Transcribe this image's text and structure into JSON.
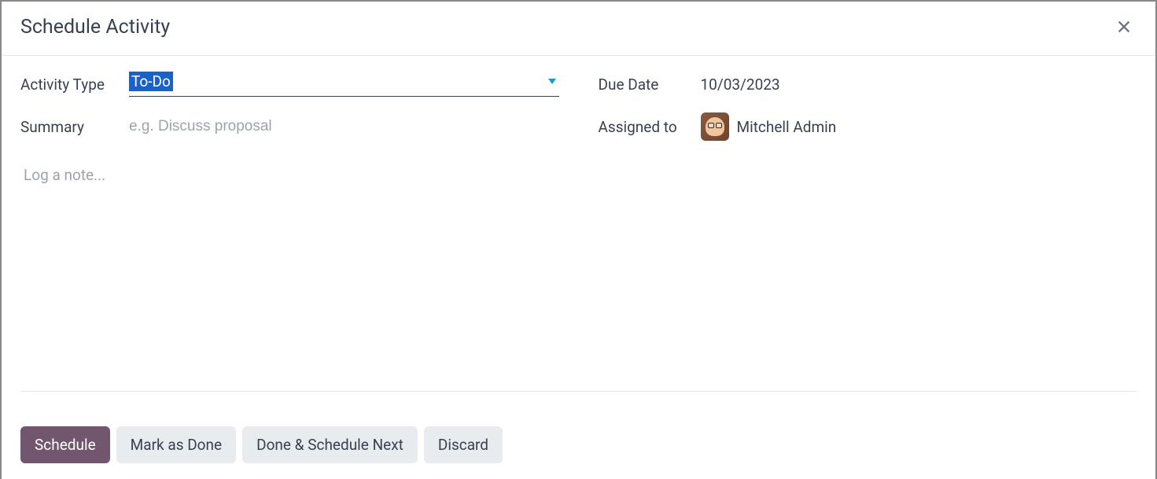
{
  "modal": {
    "title": "Schedule Activity"
  },
  "form": {
    "activity_type": {
      "label": "Activity Type",
      "value": "To-Do"
    },
    "due_date": {
      "label": "Due Date",
      "value": "10/03/2023"
    },
    "summary": {
      "label": "Summary",
      "placeholder": "e.g. Discuss proposal",
      "value": ""
    },
    "assigned_to": {
      "label": "Assigned to",
      "name": "Mitchell Admin"
    },
    "note": {
      "placeholder": "Log a note..."
    }
  },
  "footer": {
    "schedule_label": "Schedule",
    "mark_done_label": "Mark as Done",
    "done_next_label": "Done & Schedule Next",
    "discard_label": "Discard"
  }
}
